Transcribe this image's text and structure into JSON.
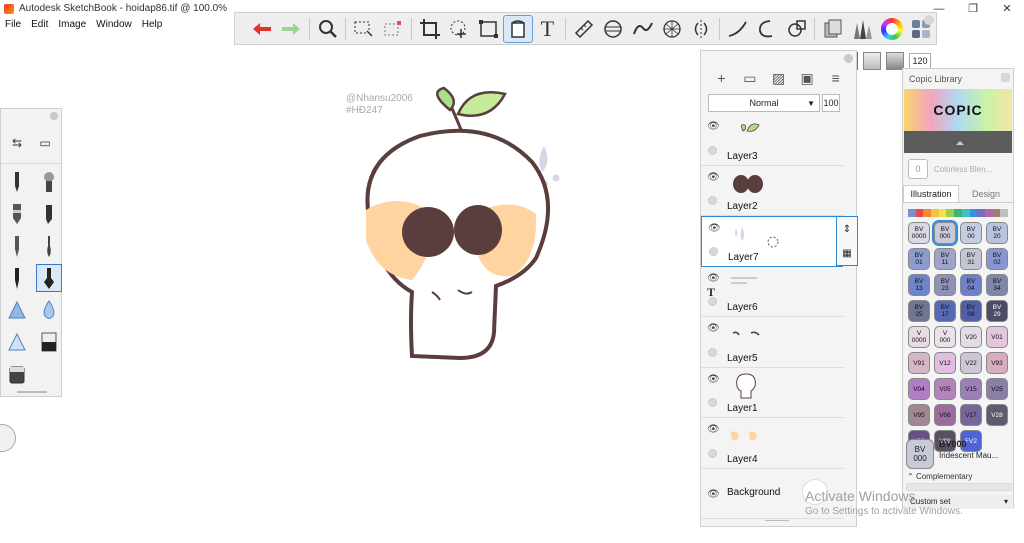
{
  "window": {
    "title": "Autodesk SketchBook - hoidap86.tif @ 100.0%",
    "controls": [
      "—",
      "❐",
      "✕"
    ]
  },
  "menu": [
    "File",
    "Edit",
    "Image",
    "Window",
    "Help"
  ],
  "canvas_text": {
    "watermark_line1": "@Nhansu2006",
    "watermark_line2": "#HĐ247"
  },
  "layers_panel": {
    "blend_mode": "Normal",
    "opacity": "100",
    "layers": [
      {
        "name": "Layer3"
      },
      {
        "name": "Layer2"
      },
      {
        "name": "Layer7",
        "selected": true
      },
      {
        "name": "Layer6",
        "type": "text"
      },
      {
        "name": "Layer5"
      },
      {
        "name": "Layer1"
      },
      {
        "name": "Layer4"
      },
      {
        "name": "Background"
      }
    ]
  },
  "brush_props": {
    "size": "120"
  },
  "copic": {
    "title": "Copic Library",
    "brand": "COPIC",
    "blender_label": "Colorless Blen...",
    "blender_code": "0",
    "tabs": [
      "Illustration",
      "Design"
    ],
    "stripe_colors": [
      "#7a8fd0",
      "#e34c4c",
      "#f28a3a",
      "#f4c342",
      "#f4e24a",
      "#9bd24b",
      "#3fb66b",
      "#40c0c8",
      "#3a8fd8",
      "#7c6bc4",
      "#b06aa8",
      "#a08070",
      "#c0c0c0"
    ],
    "markers": [
      {
        "line1": "BV",
        "line2": "0000",
        "color": "#d9d9e6"
      },
      {
        "line1": "BV",
        "line2": "000",
        "color": "#c9cad8",
        "selected": true
      },
      {
        "line1": "BV",
        "line2": "00",
        "color": "#c4cde2"
      },
      {
        "line1": "BV",
        "line2": "20",
        "color": "#b9c3e0"
      },
      {
        "line1": "BV",
        "line2": "01",
        "color": "#8d9ccf"
      },
      {
        "line1": "BV",
        "line2": "11",
        "color": "#9ea3c9"
      },
      {
        "line1": "BV",
        "line2": "31",
        "color": "#c3c4d4"
      },
      {
        "line1": "BV",
        "line2": "02",
        "color": "#8596d2"
      },
      {
        "line1": "BV",
        "line2": "13",
        "color": "#6f83c9"
      },
      {
        "line1": "BV",
        "line2": "23",
        "color": "#8e93b6"
      },
      {
        "line1": "BV",
        "line2": "04",
        "color": "#6d80c9"
      },
      {
        "line1": "BV",
        "line2": "34",
        "color": "#7f86aa"
      },
      {
        "line1": "BV",
        "line2": "25",
        "color": "#707591"
      },
      {
        "line1": "BV",
        "line2": "17",
        "color": "#5669b5"
      },
      {
        "line1": "BV",
        "line2": "08",
        "color": "#505fa8"
      },
      {
        "line1": "BV",
        "line2": "29",
        "color": "#4a4d63"
      },
      {
        "line1": "V",
        "line2": "0000",
        "color": "#e8dbe4"
      },
      {
        "line1": "V",
        "line2": "000",
        "color": "#ece0ea"
      },
      {
        "line1": "V20",
        "line2": "",
        "color": "#e2dbe8"
      },
      {
        "line1": "V01",
        "line2": "",
        "color": "#e3c6dc"
      },
      {
        "line1": "V91",
        "line2": "",
        "color": "#d5b6c4"
      },
      {
        "line1": "V12",
        "line2": "",
        "color": "#e0bde1"
      },
      {
        "line1": "V22",
        "line2": "",
        "color": "#cfc5d6"
      },
      {
        "line1": "V93",
        "line2": "",
        "color": "#d8adc2"
      },
      {
        "line1": "V04",
        "line2": "",
        "color": "#b37cc6"
      },
      {
        "line1": "V05",
        "line2": "",
        "color": "#b583bd"
      },
      {
        "line1": "V15",
        "line2": "",
        "color": "#9c7fb8"
      },
      {
        "line1": "V25",
        "line2": "",
        "color": "#8a7ea6"
      },
      {
        "line1": "V95",
        "line2": "",
        "color": "#a48795"
      },
      {
        "line1": "V06",
        "line2": "",
        "color": "#9b6c9e"
      },
      {
        "line1": "V17",
        "line2": "",
        "color": "#76669c"
      },
      {
        "line1": "V28",
        "line2": "",
        "color": "#5d5b6f"
      },
      {
        "line1": "V09",
        "line2": "",
        "color": "#6a4f86"
      },
      {
        "line1": "V99",
        "line2": "",
        "color": "#5a4f63"
      },
      {
        "line1": "FV2",
        "line2": "",
        "color": "#4d63d6"
      }
    ],
    "current_code_line1": "BV",
    "current_code_line2": "000",
    "current_code": "BV000",
    "current_name": "Iridescent Mau...",
    "complementary_label": "Complementary",
    "set_label": "Custom set"
  },
  "activation": {
    "line1": "Activate Windows",
    "line2": "Go to Settings to activate Windows."
  },
  "colors": {
    "accent": "#2f87d6",
    "skull_outline": "#5a3d3d",
    "cheek": "#ffd4a0"
  }
}
